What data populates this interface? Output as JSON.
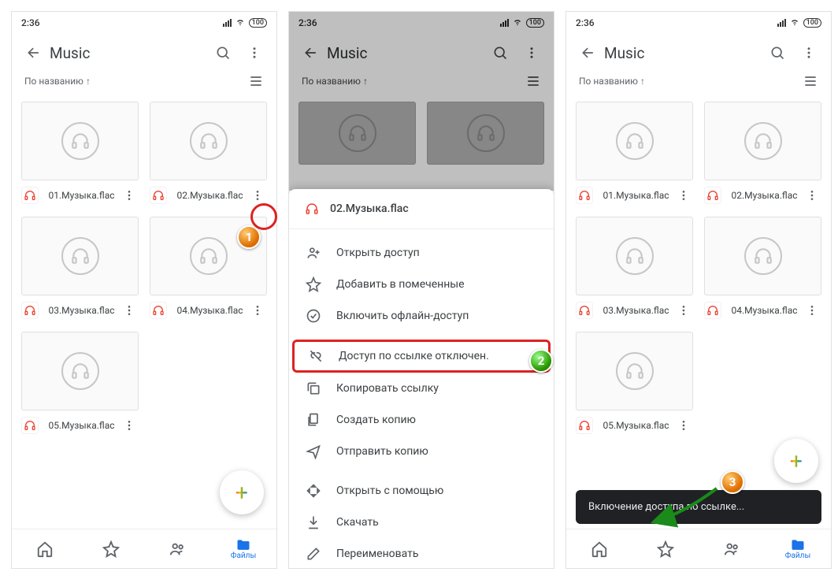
{
  "status": {
    "time": "2:36",
    "battery": "100"
  },
  "app_bar": {
    "title": "Music"
  },
  "sort": {
    "label": "По названию",
    "dir": "↑"
  },
  "files": [
    {
      "name": "01.Музыка.flac"
    },
    {
      "name": "02.Музыка.flac"
    },
    {
      "name": "03.Музыка.flac"
    },
    {
      "name": "04.Музыка.flac"
    },
    {
      "name": "05.Музыка.flac"
    }
  ],
  "bottom_nav": {
    "files": "Файлы"
  },
  "sheet": {
    "title": "02.Музыка.flac",
    "items": [
      "Открыть доступ",
      "Добавить в помеченные",
      "Включить офлайн-доступ",
      "Доступ по ссылке отключен.",
      "Копировать ссылку",
      "Создать копию",
      "Отправить копию",
      "Открыть с помощью",
      "Скачать",
      "Переименовать"
    ]
  },
  "snackbar": {
    "text": "Включение доступа по ссылке..."
  },
  "steps": {
    "s1": "1",
    "s2": "2",
    "s3": "3"
  }
}
